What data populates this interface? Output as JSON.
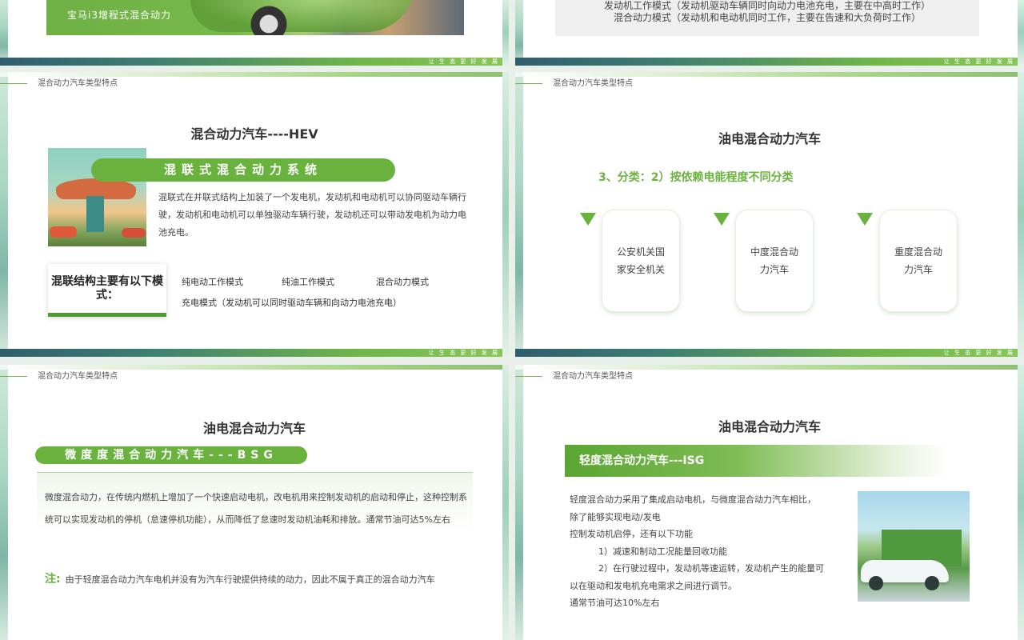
{
  "common": {
    "breadcrumb": "混合动力汽车类型特点",
    "slogan": "让 生 态 更 好 发 展"
  },
  "slide1": {
    "banner_caption": "宝马i3增程式混合动力"
  },
  "slide2": {
    "lines": [
      "发动机工作模式（发动机驱动车辆同时向动力电池充电，主要在中高时工作）",
      "混合动力模式（发动机和电动机同时工作，主要在告速和大负荷时工作）"
    ]
  },
  "slide3": {
    "title": "混合动力汽车----HEV",
    "pill": "混联式混合动力系统",
    "description": "混联式在并联式结构上加装了一个发电机，发动机和电动机可以协同驱动车辆行驶，发动机和电动机可以单独驱动车辆行驶，发动机还可以带动发电机为动力电池充电。",
    "modes_card": "混联结构主要有以下模式：",
    "modes": [
      "纯电动工作模式",
      "纯油工作模式",
      "混合动力模式",
      "充电模式（发动机可以同时驱动车辆和向动力电池充电）"
    ]
  },
  "slide4": {
    "title": "油电混合动力汽车",
    "subhead": "3、分类：2）按依赖电能程度不同分类",
    "cards": [
      "公安机关国家安全机关",
      "中度混合动力汽车",
      "重度混合动力汽车"
    ]
  },
  "slide5": {
    "title": "油电混合动力汽车",
    "pill": "微度度混合动力汽车---BSG",
    "description": "微度混合动力，在传统内燃机上增加了一个快速启动电机，改电机用来控制发动机的启动和停止，这种控制系统可以实现发动机的停机（怠速停机功能），从而降低了怠速时发动机油耗和排放。通常节油可达5%左右",
    "note_label": "注:",
    "note_text": "由于轻度混合动力汽车电机并没有为汽车行驶提供持续的动力，因此不属于真正的混合动力汽车"
  },
  "slide6": {
    "title": "油电混合动力汽车",
    "bar": "轻度混合动力汽车---ISG",
    "lines": [
      "轻度混合动力采用了集成启动电机，与微度混合动力汽车相比，",
      "除了能够实现电动/发电",
      "控制发动机启停，还有以下功能",
      "1）减速和制动工况能量回收功能",
      "2）在行驶过程中，发动机等速运转，发动机产生的能量可",
      "以在驱动和发电机充电需求之间进行调节。",
      "通常节油可达10%左右"
    ]
  }
}
